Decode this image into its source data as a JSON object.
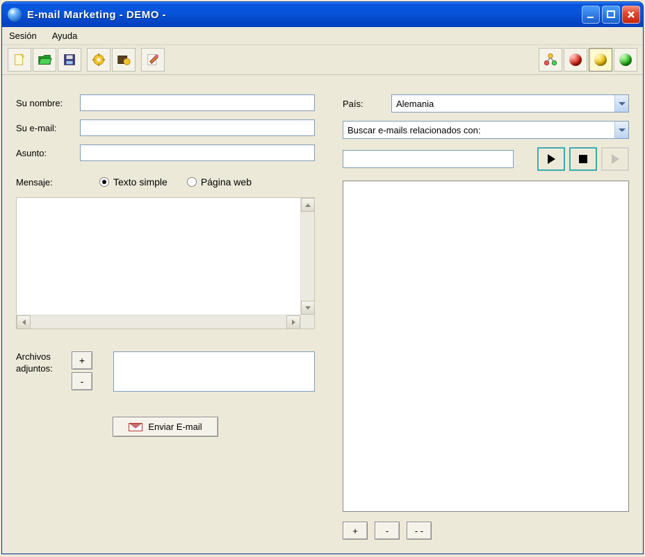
{
  "window": {
    "title": "E-mail Marketing    - DEMO -"
  },
  "menu": {
    "sesion": "Sesión",
    "ayuda": "Ayuda"
  },
  "labels": {
    "nombre": "Su nombre:",
    "email": "Su e-mail:",
    "asunto": "Asunto:",
    "mensaje": "Mensaje:",
    "adjuntos_line1": "Archivos",
    "adjuntos_line2": "adjuntos:",
    "pais": "País:"
  },
  "values": {
    "nombre": "",
    "email": "",
    "asunto": "",
    "search_term": ""
  },
  "radios": {
    "texto_simple": "Texto simple",
    "pagina_web": "Página web",
    "selected": "texto_simple"
  },
  "buttons": {
    "plus": "+",
    "minus": "-",
    "minus2": "- -",
    "enviar": "Enviar E-mail"
  },
  "combos": {
    "pais_value": "Alemania",
    "buscar_value": "Buscar e-mails relacionados con:"
  }
}
